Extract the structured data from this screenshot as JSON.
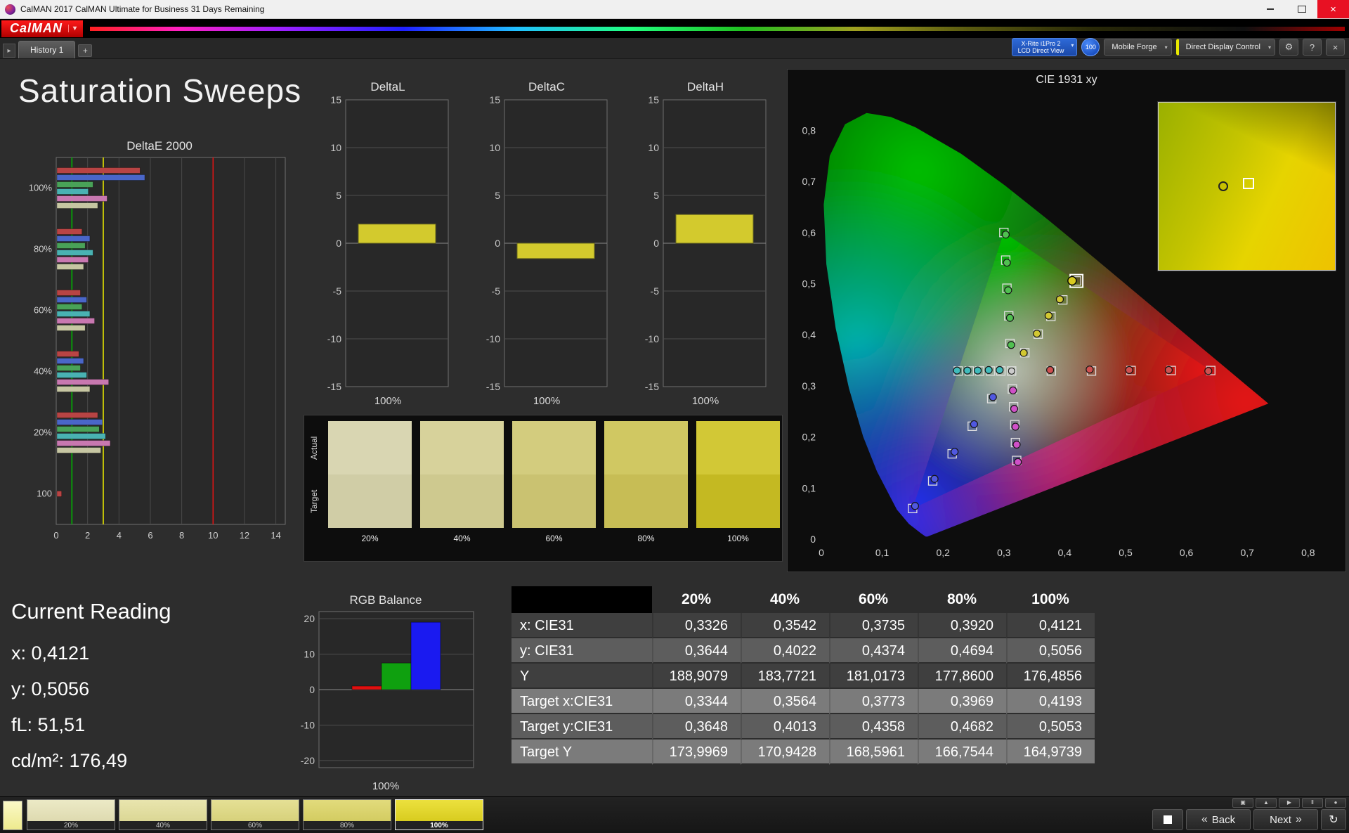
{
  "window": {
    "title": "CalMAN 2017 CalMAN Ultimate for Business 31 Days Remaining"
  },
  "brand": {
    "logo": "CalMAN"
  },
  "icons": {
    "dropdown": "▾",
    "gear": "⚙",
    "help": "?",
    "power": "×",
    "tab_scroll": "▸",
    "add_tab": "+",
    "close": "×"
  },
  "toolbar": {
    "history_tab": "History 1",
    "meter_line1": "X-Rite i1Pro 2",
    "meter_line2": "LCD Direct View",
    "meter_badge": "100",
    "source_label": "Mobile Forge",
    "workflow_label": "Direct Display Control"
  },
  "page": {
    "title": "Saturation Sweeps"
  },
  "current_reading": {
    "title": "Current Reading",
    "lines": [
      {
        "label": "x:",
        "value": "0,4121"
      },
      {
        "label": "y:",
        "value": "0,5056"
      },
      {
        "label": "fL:",
        "value": "51,51"
      },
      {
        "label": "cd/m²:",
        "value": "176,49"
      }
    ]
  },
  "results_table": {
    "header": [
      "",
      "20%",
      "40%",
      "60%",
      "80%",
      "100%"
    ],
    "rows": [
      {
        "label": "x: CIE31",
        "values": [
          "0,3326",
          "0,3542",
          "0,3735",
          "0,3920",
          "0,4121"
        ],
        "bg": "#3f3f3f"
      },
      {
        "label": "y: CIE31",
        "values": [
          "0,3644",
          "0,4022",
          "0,4374",
          "0,4694",
          "0,5056"
        ],
        "bg": "#5d5d5d"
      },
      {
        "label": "Y",
        "values": [
          "188,9079",
          "183,7721",
          "181,0173",
          "177,8600",
          "176,4856"
        ],
        "bg": "#3f3f3f"
      },
      {
        "label": "Target x:CIE31",
        "values": [
          "0,3344",
          "0,3564",
          "0,3773",
          "0,3969",
          "0,4193"
        ],
        "bg": "#7b7b7b"
      },
      {
        "label": "Target y:CIE31",
        "values": [
          "0,3648",
          "0,4013",
          "0,4358",
          "0,4682",
          "0,5053"
        ],
        "bg": "#5d5d5d"
      },
      {
        "label": "Target Y",
        "values": [
          "173,9969",
          "170,9428",
          "168,5961",
          "166,7544",
          "164,9739"
        ],
        "bg": "#7b7b7b"
      }
    ]
  },
  "bottom_bar": {
    "swatches": [
      {
        "label": "20%",
        "colors": [
          "#eceac6",
          "#dedab0"
        ],
        "selected": false
      },
      {
        "label": "40%",
        "colors": [
          "#e9e5ae",
          "#dbd795"
        ],
        "selected": false
      },
      {
        "label": "60%",
        "colors": [
          "#e5e095",
          "#d7d17b"
        ],
        "selected": false
      },
      {
        "label": "80%",
        "colors": [
          "#e2db7c",
          "#d3cc61"
        ],
        "selected": false
      },
      {
        "label": "100%",
        "colors": [
          "#ece13e",
          "#d8cc1f"
        ],
        "selected": true
      }
    ],
    "back_label": "Back",
    "next_label": "Next",
    "back_icon": "«",
    "next_icon": "»",
    "repeat_icon": "↻",
    "small_buttons": [
      {
        "name": "capture",
        "glyph": "▣"
      },
      {
        "name": "eject",
        "glyph": "▲"
      },
      {
        "name": "play",
        "glyph": "▶"
      },
      {
        "name": "pause",
        "glyph": "Ⅱ"
      },
      {
        "name": "record",
        "glyph": "●"
      }
    ]
  },
  "chart_data": [
    {
      "id": "deltae2000",
      "type": "bar",
      "orientation": "horizontal",
      "title": "DeltaE 2000",
      "group_labels": [
        "100%",
        "80%",
        "60%",
        "40%",
        "20%",
        "100"
      ],
      "bar_colors": [
        "#b84444",
        "#4a66c8",
        "#49a258",
        "#49b2b2",
        "#c878b0",
        "#c6c6a2"
      ],
      "groups": [
        [
          5.3,
          5.6,
          2.3,
          2.0,
          3.2,
          2.6
        ],
        [
          1.6,
          2.1,
          1.8,
          2.3,
          2.0,
          1.7
        ],
        [
          1.5,
          1.9,
          1.6,
          2.1,
          2.4,
          1.8
        ],
        [
          1.4,
          1.7,
          1.5,
          1.9,
          3.3,
          2.1
        ],
        [
          2.6,
          2.9,
          2.7,
          3.1,
          3.4,
          2.8
        ],
        [
          0.3
        ]
      ],
      "xticks": [
        0,
        2,
        4,
        6,
        8,
        10,
        12,
        14
      ],
      "xlim": [
        0,
        14.6
      ],
      "ref_lines": [
        {
          "value": 1,
          "color": "#00b400"
        },
        {
          "value": 3,
          "color": "#e6e600"
        },
        {
          "value": 10,
          "color": "#dc1414"
        }
      ]
    },
    {
      "id": "deltaL",
      "type": "bar",
      "title": "DeltaL",
      "values": [
        2.0
      ],
      "xlabel": "100%",
      "ylim": [
        -15,
        15
      ],
      "yticks": [
        15,
        10,
        5,
        0,
        -5,
        -10,
        -15
      ],
      "bar_color": "#d3ca2d"
    },
    {
      "id": "deltaC",
      "type": "bar",
      "title": "DeltaC",
      "values": [
        -1.6
      ],
      "xlabel": "100%",
      "ylim": [
        -15,
        15
      ],
      "yticks": [
        15,
        10,
        5,
        0,
        -5,
        -10,
        -15
      ],
      "bar_color": "#d3ca2d"
    },
    {
      "id": "deltaH",
      "type": "bar",
      "title": "DeltaH",
      "values": [
        3.0
      ],
      "xlabel": "100%",
      "ylim": [
        -15,
        15
      ],
      "yticks": [
        15,
        10,
        5,
        0,
        -5,
        -10,
        -15
      ],
      "bar_color": "#d3ca2d"
    },
    {
      "id": "rgb_balance",
      "type": "bar",
      "title": "RGB Balance",
      "xlabel": "100%",
      "ylim": [
        -20,
        20
      ],
      "yticks": [
        20,
        10,
        0,
        -10,
        -20
      ],
      "series": [
        {
          "name": "Red",
          "color": "#e01010",
          "value": 1
        },
        {
          "name": "Green",
          "color": "#0fa00f",
          "value": 7.5
        },
        {
          "name": "Blue",
          "color": "#1a1af0",
          "value": 19
        }
      ]
    },
    {
      "id": "cie",
      "type": "scatter",
      "title": "CIE 1931 xy",
      "xticks": [
        "0",
        "0,1",
        "0,2",
        "0,3",
        "0,4",
        "0,5",
        "0,6",
        "0,7",
        "0,8"
      ],
      "yticks": [
        "0,8",
        "0,7",
        "0,6",
        "0,5",
        "0,4",
        "0,3",
        "0,2",
        "0,1",
        "0"
      ],
      "xlim": [
        0,
        0.84
      ],
      "ylim": [
        0,
        0.86
      ],
      "gamut_triangle": {
        "red": [
          0.64,
          0.33
        ],
        "green": [
          0.3,
          0.6
        ],
        "blue": [
          0.15,
          0.06
        ]
      },
      "white_point": [
        0.3127,
        0.329
      ],
      "sweeps": [
        {
          "name": "red",
          "color": "#d05050",
          "targets": [
            [
              0.378,
              0.329
            ],
            [
              0.444,
              0.329
            ],
            [
              0.509,
              0.33
            ],
            [
              0.575,
              0.33
            ],
            [
              0.64,
              0.33
            ]
          ],
          "measured": [
            [
              0.376,
              0.331
            ],
            [
              0.441,
              0.332
            ],
            [
              0.506,
              0.331
            ],
            [
              0.571,
              0.331
            ],
            [
              0.636,
              0.329
            ]
          ]
        },
        {
          "name": "green",
          "color": "#50c050",
          "targets": [
            [
              0.31,
              0.383
            ],
            [
              0.308,
              0.437
            ],
            [
              0.305,
              0.491
            ],
            [
              0.303,
              0.546
            ],
            [
              0.3,
              0.6
            ]
          ],
          "measured": [
            [
              0.312,
              0.38
            ],
            [
              0.31,
              0.433
            ],
            [
              0.307,
              0.487
            ],
            [
              0.305,
              0.541
            ],
            [
              0.303,
              0.596
            ]
          ]
        },
        {
          "name": "blue",
          "color": "#5058e0",
          "targets": [
            [
              0.28,
              0.275
            ],
            [
              0.248,
              0.221
            ],
            [
              0.215,
              0.167
            ],
            [
              0.183,
              0.114
            ],
            [
              0.15,
              0.06
            ]
          ],
          "measured": [
            [
              0.282,
              0.278
            ],
            [
              0.251,
              0.225
            ],
            [
              0.219,
              0.171
            ],
            [
              0.186,
              0.118
            ],
            [
              0.154,
              0.065
            ]
          ]
        },
        {
          "name": "cyan",
          "color": "#40bcbc",
          "targets": [
            [
              0.295,
              0.329
            ],
            [
              0.278,
              0.329
            ],
            [
              0.26,
              0.329
            ],
            [
              0.243,
              0.329
            ],
            [
              0.225,
              0.329
            ]
          ],
          "measured": [
            [
              0.293,
              0.331
            ],
            [
              0.275,
              0.331
            ],
            [
              0.257,
              0.33
            ],
            [
              0.24,
              0.33
            ],
            [
              0.223,
              0.33
            ]
          ]
        },
        {
          "name": "magenta",
          "color": "#d050c8",
          "targets": [
            [
              0.314,
              0.294
            ],
            [
              0.316,
              0.259
            ],
            [
              0.318,
              0.224
            ],
            [
              0.319,
              0.189
            ],
            [
              0.321,
              0.154
            ]
          ],
          "measured": [
            [
              0.315,
              0.291
            ],
            [
              0.317,
              0.255
            ],
            [
              0.319,
              0.22
            ],
            [
              0.321,
              0.185
            ],
            [
              0.323,
              0.151
            ]
          ]
        },
        {
          "name": "yellow",
          "color": "#d2c832",
          "targets": [
            [
              0.3344,
              0.3648
            ],
            [
              0.3564,
              0.4013
            ],
            [
              0.3773,
              0.4358
            ],
            [
              0.3969,
              0.4682
            ],
            [
              0.4193,
              0.5053
            ]
          ],
          "measured": [
            [
              0.3326,
              0.3644
            ],
            [
              0.3542,
              0.4022
            ],
            [
              0.3735,
              0.4374
            ],
            [
              0.392,
              0.4694
            ],
            [
              0.4121,
              0.5056
            ]
          ]
        }
      ],
      "current": {
        "target": [
          0.4193,
          0.5053
        ],
        "measured": [
          0.4121,
          0.5056
        ]
      }
    },
    {
      "id": "saturation_swatches",
      "type": "table",
      "row_labels": [
        "Actual",
        "Target"
      ],
      "column_labels": [
        "20%",
        "40%",
        "60%",
        "80%",
        "100%"
      ],
      "actual_colors": [
        "#d9d6b2",
        "#d7d29b",
        "#d3cc7e",
        "#d0c862",
        "#d2c836"
      ],
      "target_colors": [
        "#d0cda6",
        "#cec98f",
        "#cac271",
        "#c7bd55",
        "#c4b922"
      ]
    }
  ]
}
